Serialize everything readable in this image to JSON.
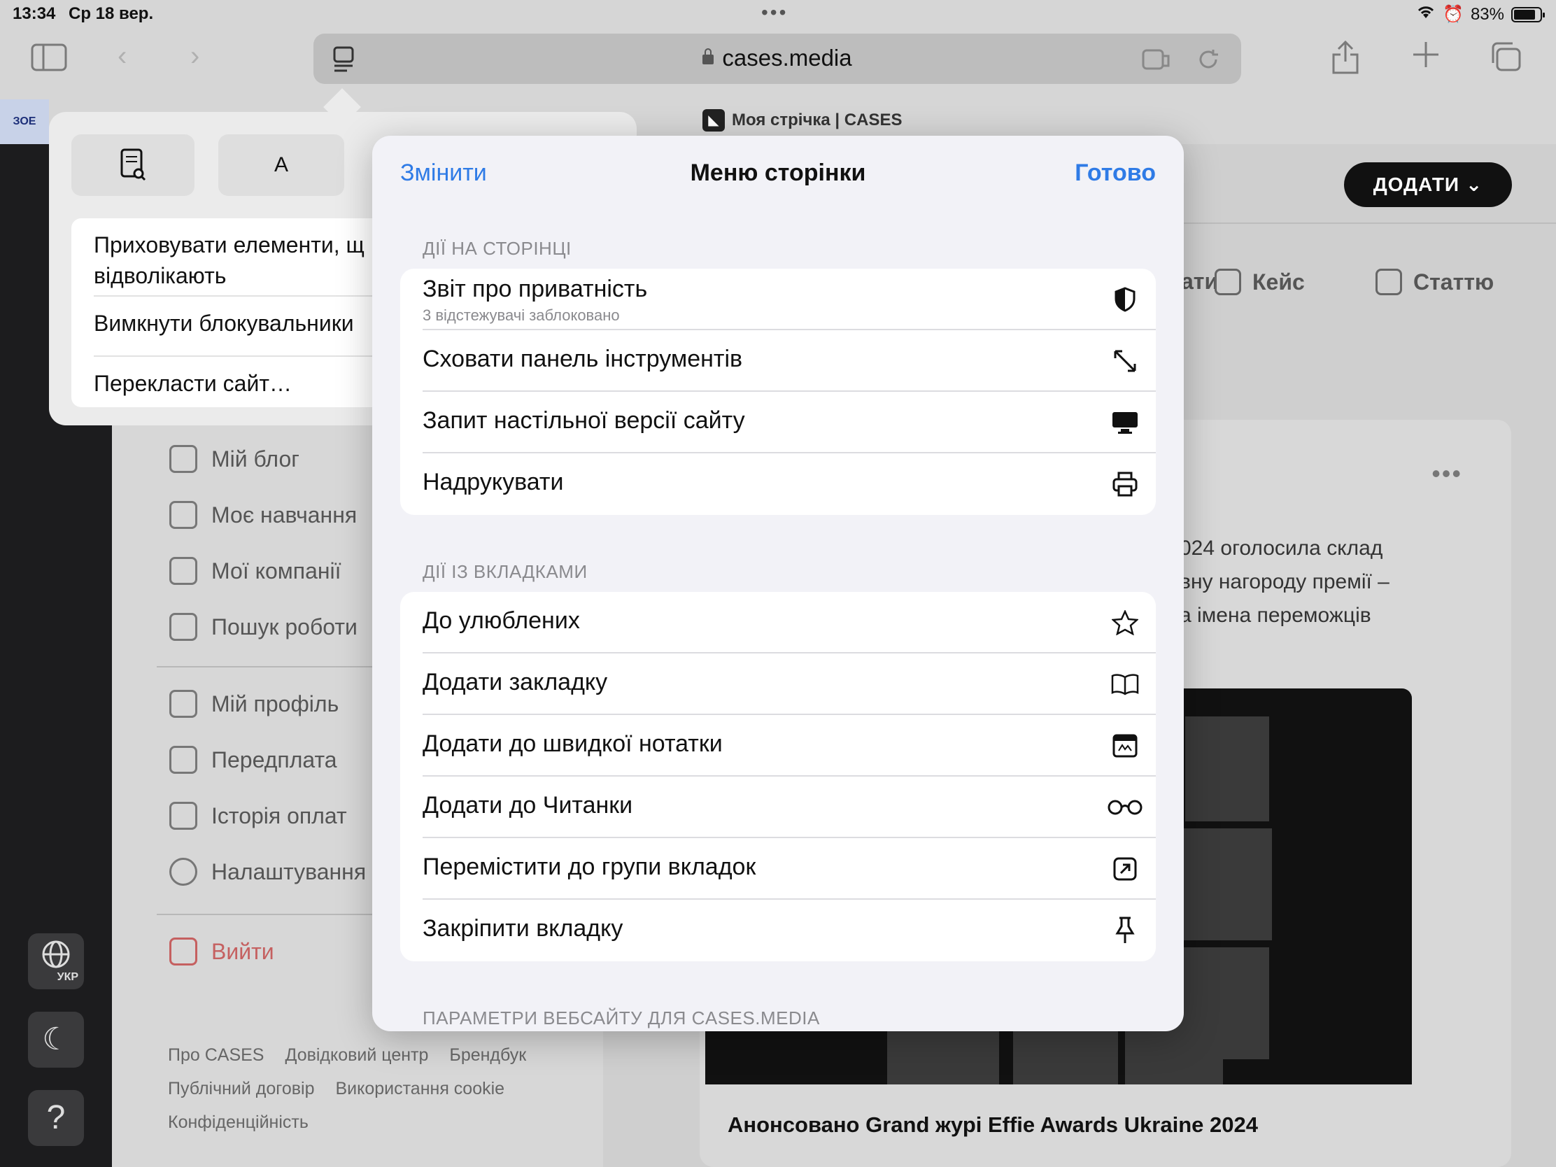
{
  "status_bar": {
    "time": "13:34",
    "date": "Ср 18 вер.",
    "battery": "83%",
    "battery_level": 0.83
  },
  "browser": {
    "url": "cases.media",
    "tab_title": "Моя стрічка | CASES",
    "left_favicon": "ЗОЕ"
  },
  "page_menu_popover": {
    "reader_icon": "page-search-icon",
    "font_label": "A",
    "items": [
      "Приховувати елементи, що відволікають",
      "Вимкнути блокувальники",
      "Перекласти сайт…"
    ],
    "item_line1": "Приховувати елементи, щ",
    "item_line2": "відволікають"
  },
  "sheet": {
    "edit_label": "Змінити",
    "title": "Меню сторінки",
    "done_label": "Готово",
    "sections": [
      {
        "header": "ДІЇ НА СТОРІНЦІ",
        "rows": [
          {
            "label": "Звіт про приватність",
            "sub": "3 відстежувачі заблоковано",
            "icon": "shield-half-icon"
          },
          {
            "label": "Сховати панель інструментів",
            "icon": "arrows-expand-icon"
          },
          {
            "label": "Запит настільної версії сайту",
            "icon": "desktop-icon"
          },
          {
            "label": "Надрукувати",
            "icon": "printer-icon"
          }
        ]
      },
      {
        "header": "ДІЇ ІЗ ВКЛАДКАМИ",
        "rows": [
          {
            "label": "До улюблених",
            "icon": "star-icon"
          },
          {
            "label": "Додати закладку",
            "icon": "book-icon"
          },
          {
            "label": "Додати до швидкої нотатки",
            "icon": "quick-note-icon"
          },
          {
            "label": "Додати до Читанки",
            "icon": "glasses-icon"
          },
          {
            "label": "Перемістити до групи вкладок",
            "icon": "move-to-group-icon"
          },
          {
            "label": "Закріпити вкладку",
            "icon": "pin-icon"
          }
        ]
      },
      {
        "header": "ПАРАМЕТРИ ВЕБСАЙТУ ДЛЯ CASES.MEDIA"
      }
    ]
  },
  "sidebar": {
    "items": [
      {
        "label": "Мій блог",
        "icon": "blog-icon"
      },
      {
        "label": "Моє навчання",
        "icon": "graduation-icon"
      },
      {
        "label": "Мої компанії",
        "icon": "building-icon"
      },
      {
        "label": "Пошук роботи",
        "icon": "job-search-icon"
      },
      {
        "label": "Мій профіль",
        "icon": "user-icon"
      },
      {
        "label": "Передплата",
        "icon": "subscription-icon"
      },
      {
        "label": "Історія оплат",
        "icon": "receipt-icon"
      },
      {
        "label": "Налаштування",
        "icon": "gear-icon"
      }
    ],
    "logout": "Вийти",
    "footer": [
      "Про CASES",
      "Довідковий центр",
      "Брендбук",
      "Публічний договір",
      "Використання cookie",
      "Конфіденційність"
    ]
  },
  "rail": {
    "lang": "УКР"
  },
  "content": {
    "add_button": "ДОДАТИ",
    "chips": [
      "ати",
      "Кейс",
      "Статтю"
    ],
    "card_text_lines": [
      "024 оголосила склад",
      "вну нагороду премії –",
      "а імена переможців"
    ],
    "card_title": "Анонсовано Grand журі Effie Awards Ukraine 2024"
  }
}
